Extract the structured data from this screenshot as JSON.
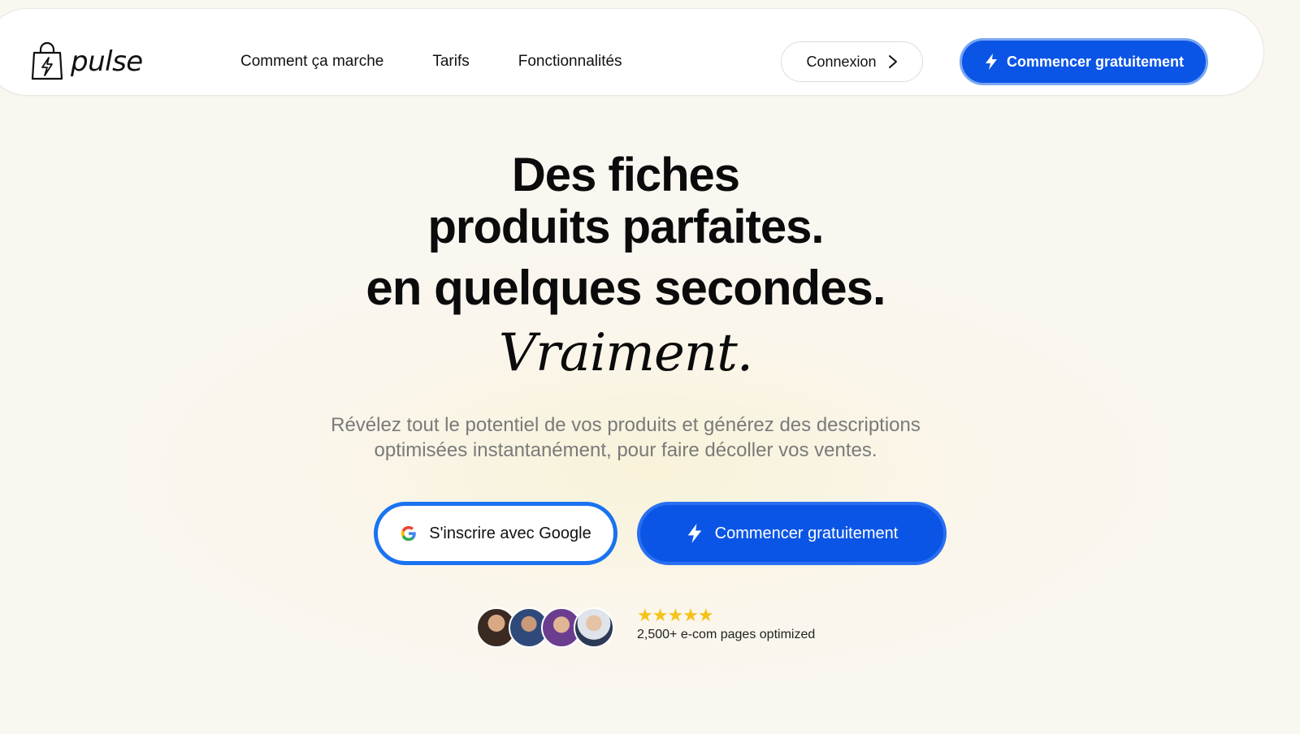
{
  "brand": {
    "name": "pulse",
    "logo_icon": "shopping-bag-bolt-icon"
  },
  "nav": {
    "links": [
      "Comment ça marche",
      "Tarifs",
      "Fonctionnalités"
    ],
    "login_label": "Connexion",
    "cta_label": "Commencer gratuitement"
  },
  "hero": {
    "line1": "Des fiches",
    "line2": "produits parfaites.",
    "line3": "en quelques secondes.",
    "line4": "Vraiment.",
    "subtitle_line1": "Révélez tout le potentiel de vos produits et générez des descriptions",
    "subtitle_line2": "optimisées instantanément, pour faire décoller vos ventes.",
    "google_button_label": "S'inscrire avec Google",
    "cta_label": "Commencer gratuitement"
  },
  "social_proof": {
    "stars": "★★★★★",
    "rating_value": 5,
    "text": "2,500+ e-com pages optimized",
    "avatar_count": 4
  },
  "colors": {
    "primary": "#0b55e6",
    "google_border": "#1a73f0",
    "star": "#f5c218",
    "background": "#faf7f1"
  }
}
